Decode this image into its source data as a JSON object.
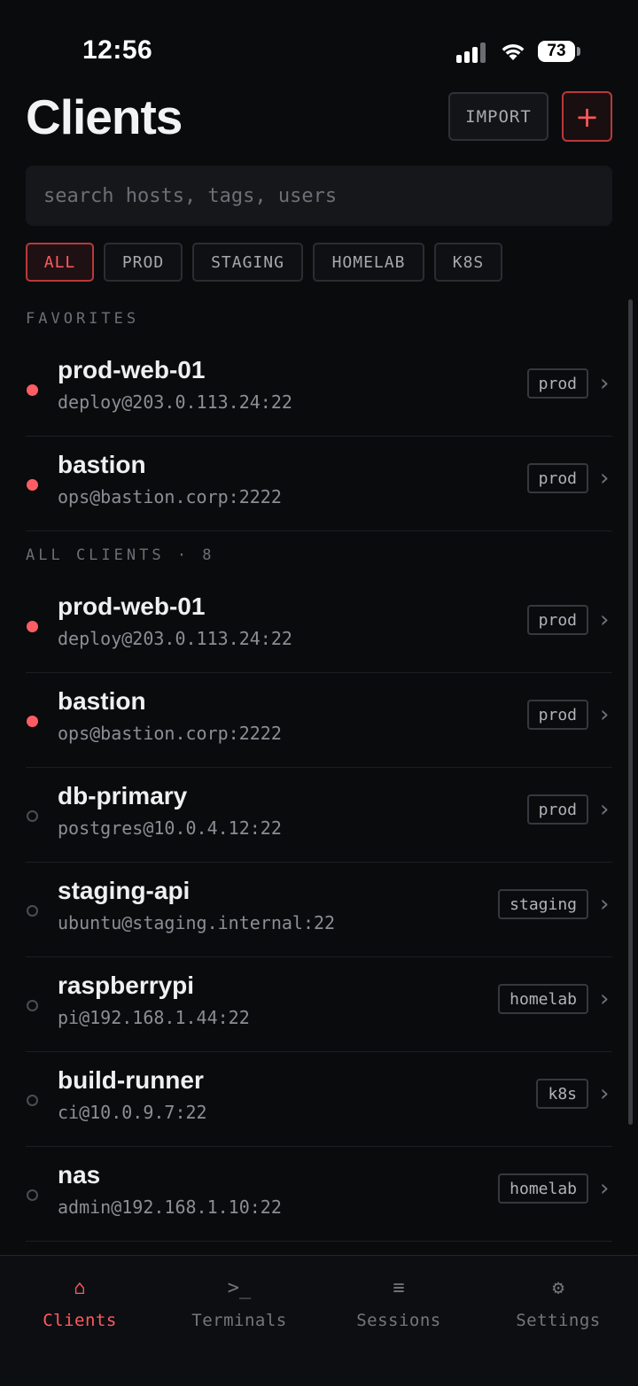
{
  "status_bar": {
    "time": "12:56",
    "battery": "73"
  },
  "header": {
    "title": "Clients",
    "import_label": "IMPORT",
    "add_label": "+"
  },
  "search": {
    "placeholder": "search hosts, tags, users"
  },
  "filters": [
    "ALL",
    "PROD",
    "STAGING",
    "HOMELAB",
    "K8S"
  ],
  "sections": {
    "favorites": "FAVORITES",
    "all_clients": "ALL CLIENTS · 8"
  },
  "favorites": [
    {
      "name": "prod-web-01",
      "address": "deploy@203.0.113.24:22",
      "tag": "prod",
      "status": "online"
    },
    {
      "name": "bastion",
      "address": "ops@bastion.corp:2222",
      "tag": "prod",
      "status": "online"
    }
  ],
  "clients": [
    {
      "name": "prod-web-01",
      "address": "deploy@203.0.113.24:22",
      "tag": "prod",
      "status": "online"
    },
    {
      "name": "bastion",
      "address": "ops@bastion.corp:2222",
      "tag": "prod",
      "status": "online"
    },
    {
      "name": "db-primary",
      "address": "postgres@10.0.4.12:22",
      "tag": "prod",
      "status": "offline"
    },
    {
      "name": "staging-api",
      "address": "ubuntu@staging.internal:22",
      "tag": "staging",
      "status": "offline"
    },
    {
      "name": "raspberrypi",
      "address": "pi@192.168.1.44:22",
      "tag": "homelab",
      "status": "offline"
    },
    {
      "name": "build-runner",
      "address": "ci@10.0.9.7:22",
      "tag": "k8s",
      "status": "offline"
    },
    {
      "name": "nas",
      "address": "admin@192.168.1.10:22",
      "tag": "homelab",
      "status": "offline"
    }
  ],
  "tabs": [
    {
      "icon": "⌂",
      "label": "Clients"
    },
    {
      "icon": ">_",
      "label": "Terminals"
    },
    {
      "icon": "≡",
      "label": "Sessions"
    },
    {
      "icon": "⚙",
      "label": "Settings"
    }
  ],
  "colors": {
    "accent": "#ff5a5f",
    "background": "#0a0b0d",
    "online": "#ff5c63"
  }
}
